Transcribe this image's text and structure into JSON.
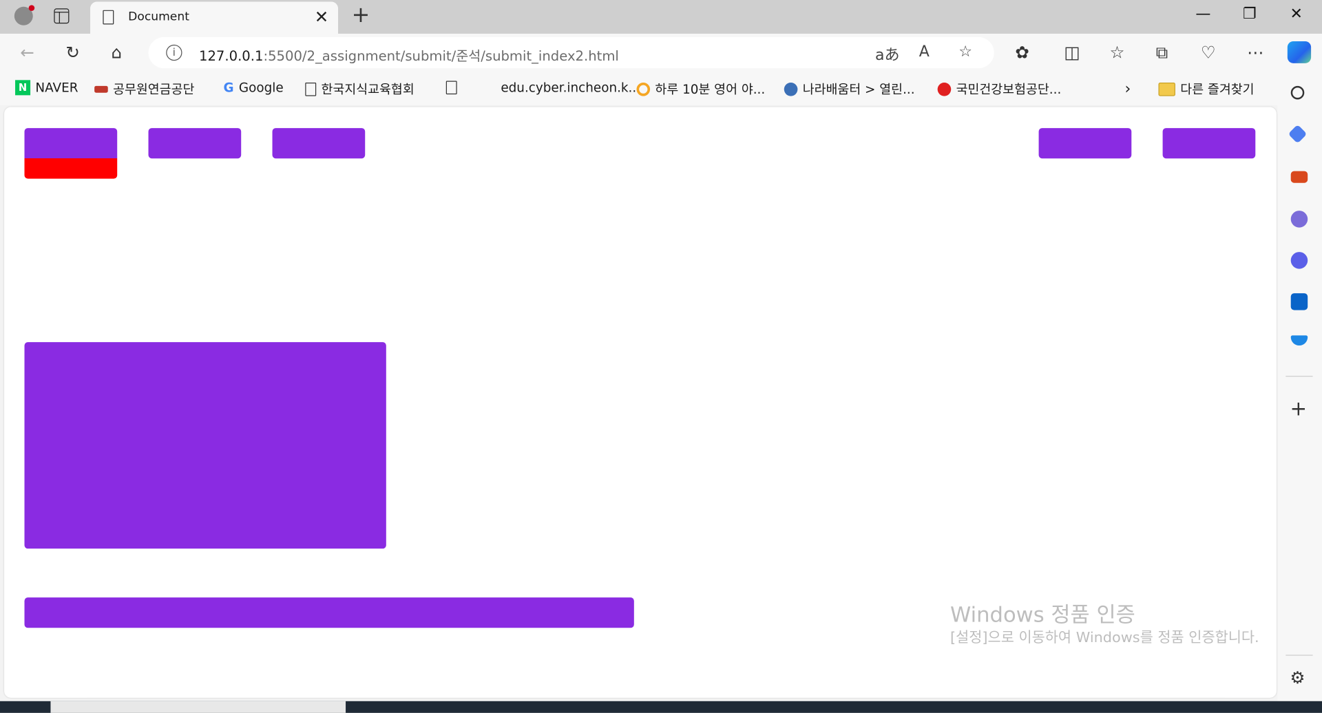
{
  "browser": {
    "tab_title": "Document",
    "address_host": "127.0.0.1",
    "address_rest": ":5500/2_assignment/submit/준석/submit_index2.html"
  },
  "bookmarks": [
    {
      "label": "NAVER"
    },
    {
      "label": "공무원연금공단"
    },
    {
      "label": "Google"
    },
    {
      "label": "한국지식교육협회"
    },
    {
      "label": "edu.cyber.incheon.k..."
    },
    {
      "label": "하루 10분 영어 야..."
    },
    {
      "label": "나라배움터 > 열린..."
    },
    {
      "label": "국민건강보험공단..."
    }
  ],
  "other_favorites": "다른 즐겨찾기",
  "colors": {
    "box": "#8a2be2",
    "box_accent": "#ff0000"
  },
  "watermark": {
    "title": "Windows 정품 인증",
    "text": "[설정]으로 이동하여 Windows를 정품 인증합니다."
  }
}
